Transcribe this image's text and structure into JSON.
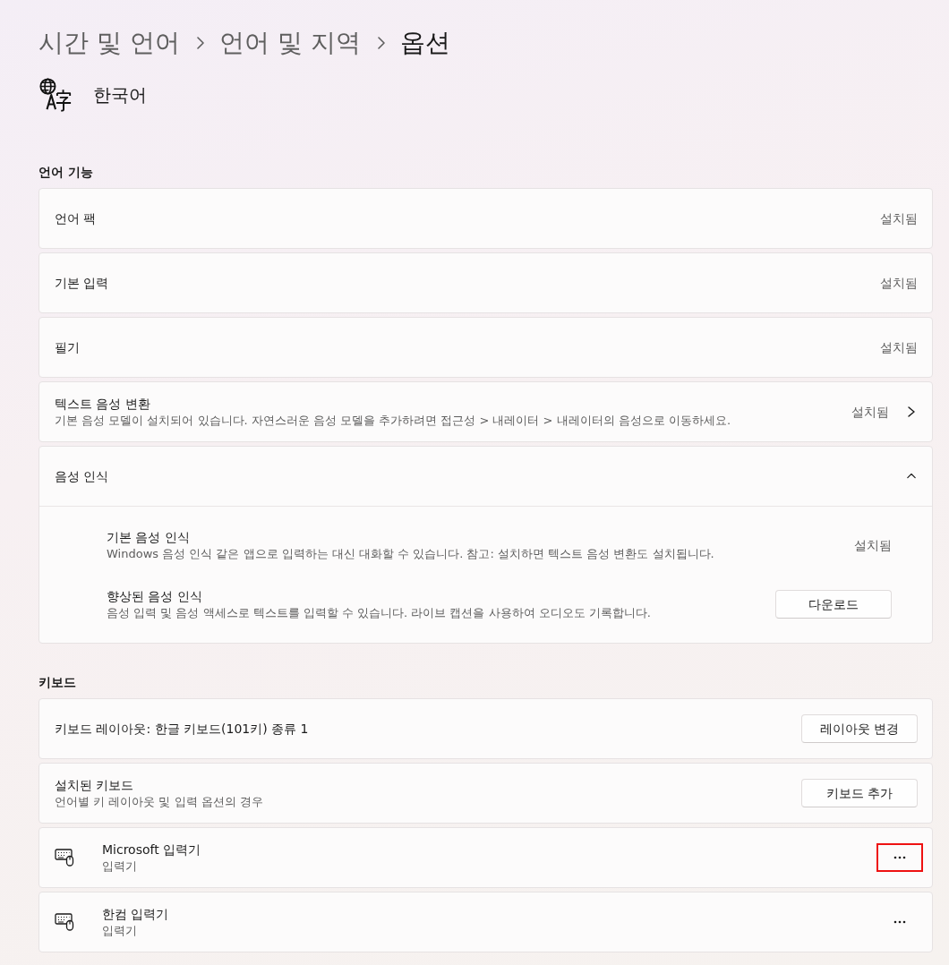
{
  "breadcrumb": [
    {
      "label": "시간 및 언어",
      "current": false
    },
    {
      "label": "언어 및 지역",
      "current": false
    },
    {
      "label": "옵션",
      "current": true
    }
  ],
  "language": {
    "name": "한국어"
  },
  "sections": [
    {
      "title": "언어 기능",
      "items": [
        {
          "kind": "status",
          "title": "언어 팩",
          "status": "설치됨"
        },
        {
          "kind": "status",
          "title": "기본 입력",
          "status": "설치됨"
        },
        {
          "kind": "status",
          "title": "필기",
          "status": "설치됨"
        },
        {
          "kind": "link",
          "title": "텍스트 음성 변환",
          "description": "기본 음성 모델이 설치되어 있습니다. 자연스러운 음성 모델을 추가하려면 접근성 > 내레이터 > 내레이터의 음성으로 이동하세요.",
          "status": "설치됨"
        },
        {
          "kind": "expander",
          "title": "음성 인식",
          "expanded": true,
          "children": [
            {
              "kind": "status",
              "title": "기본 음성 인식",
              "description": "Windows 음성 인식 같은 앱으로 입력하는 대신 대화할 수 있습니다. 참고: 설치하면 텍스트 음성 변환도 설치됩니다.",
              "status": "설치됨"
            },
            {
              "kind": "button",
              "title": "향상된 음성 인식",
              "description": "음성 입력 및 음성 액세스로 텍스트를 입력할 수 있습니다. 라이브 캡션을 사용하여 오디오도 기록합니다.",
              "button": "다운로드"
            }
          ]
        }
      ]
    },
    {
      "title": "키보드",
      "items": [
        {
          "kind": "button",
          "title": "키보드 레이아웃: 한글 키보드(101키) 종류 1",
          "button": "레이아웃 변경"
        },
        {
          "kind": "button",
          "title": "설치된 키보드",
          "description": "언어별 키 레이아웃 및 입력 옵션의 경우",
          "button": "키보드 추가"
        },
        {
          "kind": "keyboard",
          "title": "Microsoft 입력기",
          "description": "입력기",
          "highlighted": true
        },
        {
          "kind": "keyboard",
          "title": "한컴 입력기",
          "description": "입력기",
          "highlighted": false
        }
      ]
    }
  ]
}
